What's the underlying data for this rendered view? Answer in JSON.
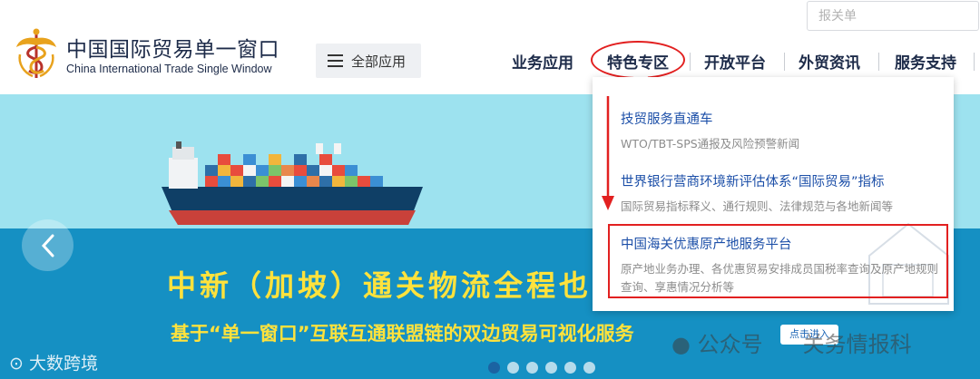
{
  "header": {
    "brand_cn": "中国国际贸易单一窗口",
    "brand_en": "China International Trade Single Window",
    "all_apps_label": "全部应用",
    "search_placeholder": "报关单",
    "nav": [
      "业务应用",
      "特色专区",
      "开放平台",
      "外贸资讯",
      "服务支持"
    ],
    "highlighted_nav": "特色专区"
  },
  "dropdown": {
    "items": [
      {
        "title": "技贸服务直通车",
        "desc": "WTO/TBT-SPS通报及风险预警新闻"
      },
      {
        "title": "世界银行营商环境新评估体系“国际贸易”指标",
        "desc": "国际贸易指标释义、通行规则、法律规范与各地新闻等"
      },
      {
        "title": "中国海关优惠原产地服务平台",
        "desc": "原产地业务办理、各优惠贸易安排成员国税率查询及原产地规则查询、享惠情况分析等"
      }
    ]
  },
  "banner": {
    "title": "中新（加坡）通关物流全程也",
    "subtitle": "基于“单一窗口”互联互通联盟链的双边贸易可视化服务",
    "click_label": "点击进入",
    "slide_count": 6,
    "active_slide": 1
  },
  "watermarks": {
    "left": "大数跨境",
    "right_prefix": "公众号",
    "right_name": "关务情报科"
  },
  "colors": {
    "nav_text": "#1d2b49",
    "link_blue": "#1c4fa8",
    "highlight_red": "#e22020",
    "banner_yellow": "#ffe23c",
    "sky": "#9de2ef",
    "sea": "#1590c3"
  }
}
